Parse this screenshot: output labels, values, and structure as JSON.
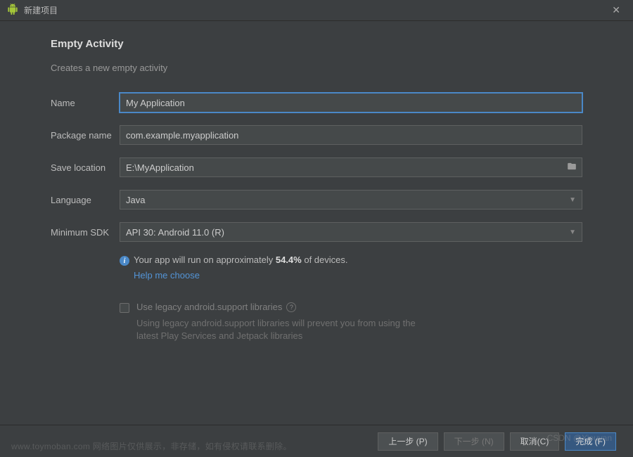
{
  "window": {
    "title": "新建项目"
  },
  "page": {
    "heading": "Empty Activity",
    "subtitle": "Creates a new empty activity"
  },
  "form": {
    "name": {
      "label": "Name",
      "value": "My Application"
    },
    "package": {
      "label": "Package name",
      "value": "com.example.myapplication"
    },
    "saveLocation": {
      "label": "Save location",
      "value": "E:\\MyApplication"
    },
    "language": {
      "label": "Language",
      "value": "Java"
    },
    "minSdk": {
      "label": "Minimum SDK",
      "value": "API 30: Android 11.0 (R)"
    }
  },
  "info": {
    "prefix": "Your app will run on approximately ",
    "percent": "54.4%",
    "suffix": " of devices.",
    "helpLink": "Help me choose"
  },
  "legacy": {
    "label": "Use legacy android.support libraries",
    "description": "Using legacy android.support libraries will prevent you from using the latest Play Services and Jetpack libraries",
    "checked": false
  },
  "buttons": {
    "previous": "上一步 (P)",
    "next": "下一步 (N)",
    "cancel": "取消(C)",
    "finish": "完成 (F)"
  },
  "watermarks": {
    "bottomLeft": "www.toymoban.com 网络图片仅供展示，非存储，如有侵权请联系删除。",
    "bottomRight": "CSDN @Yiouyan"
  }
}
